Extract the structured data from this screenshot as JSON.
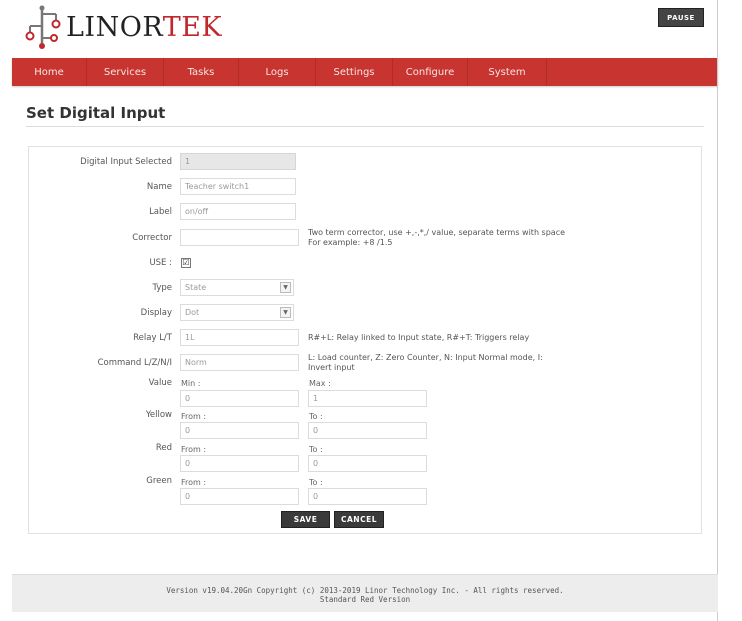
{
  "header": {
    "brand_part1": "LINOR",
    "brand_part2": "TEK",
    "pause_label": "PAUSE"
  },
  "nav": {
    "items": [
      {
        "label": "Home"
      },
      {
        "label": "Services"
      },
      {
        "label": "Tasks"
      },
      {
        "label": "Logs"
      },
      {
        "label": "Settings"
      },
      {
        "label": "Configure"
      },
      {
        "label": "System"
      }
    ]
  },
  "page": {
    "title": "Set Digital Input"
  },
  "form": {
    "digital_input_selected": {
      "label": "Digital Input Selected",
      "value": "1"
    },
    "name": {
      "label": "Name",
      "value": "Teacher switch1"
    },
    "label_field": {
      "label": "Label",
      "value": "on/off"
    },
    "corrector": {
      "label": "Corrector",
      "value": "",
      "hint_line1": "Two term corrector, use +,-,*,/ value, separate terms with space",
      "hint_line2": "For example: +8 /1.5"
    },
    "use": {
      "label": "USE :",
      "checked": true,
      "mark": "☑"
    },
    "type": {
      "label": "Type",
      "value": "State"
    },
    "display": {
      "label": "Display",
      "value": "Dot"
    },
    "relay": {
      "label": "Relay L/T",
      "value": "1L",
      "hint": "R#+L: Relay linked to Input state, R#+T: Triggers relay"
    },
    "command": {
      "label": "Command L/Z/N/I",
      "value": "Norm",
      "hint_line1": "L: Load counter, Z: Zero Counter, N: Input Normal mode, I:",
      "hint_line2": "Invert input"
    },
    "value": {
      "label": "Value",
      "min_label": "Min :",
      "min_value": "0",
      "max_label": "Max :",
      "max_value": "1"
    },
    "yellow": {
      "label": "Yellow",
      "from_label": "From :",
      "from_value": "0",
      "to_label": "To :",
      "to_value": "0"
    },
    "red": {
      "label": "Red",
      "from_label": "From :",
      "from_value": "0",
      "to_label": "To :",
      "to_value": "0"
    },
    "green": {
      "label": "Green",
      "from_label": "From :",
      "from_value": "0",
      "to_label": "To :",
      "to_value": "0"
    },
    "save_label": "SAVE",
    "cancel_label": "CANCEL"
  },
  "footer": {
    "line1": "Version v19.04.20Gn Copyright (c) 2013-2019 Linor Technology Inc. - All rights reserved.",
    "line2": "Standard Red Version"
  },
  "colors": {
    "brand_red": "#c8342f",
    "nav_text": "#f5e6e4",
    "button_dark": "#3a3a3a"
  },
  "icons": {
    "logo": "circuit-node-logo-icon",
    "select": "chevron-down-icon",
    "checkbox": "checkbox-checked-icon"
  }
}
